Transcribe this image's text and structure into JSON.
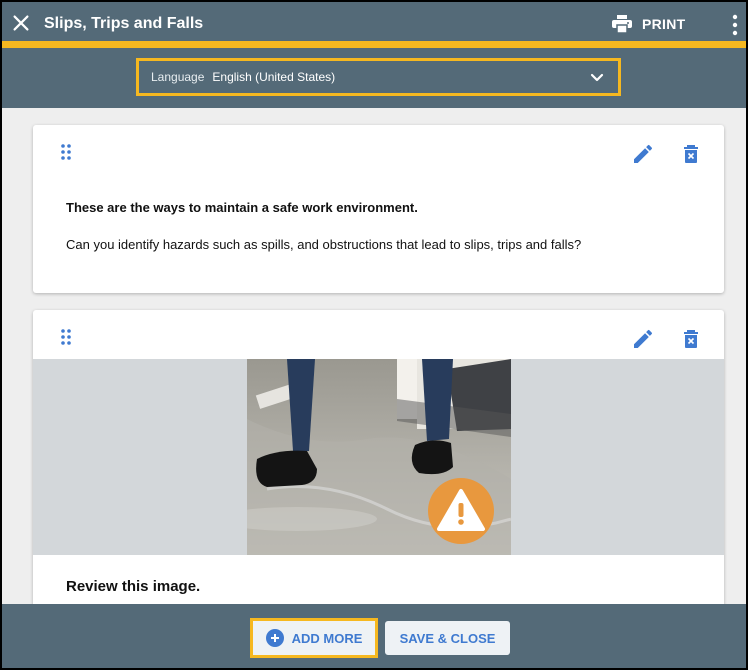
{
  "header": {
    "title": "Slips, Trips and Falls",
    "print_label": "PRINT",
    "accent_color": "#f6b820",
    "bar_color": "#546a78"
  },
  "language": {
    "label": "Language",
    "value": "English (United States)"
  },
  "cards": [
    {
      "heading": "These are the ways to maintain a safe work environment.",
      "body": "Can you identify hazards such as spills, and obstructions that lead to slips, trips and falls?"
    },
    {
      "caption": "Review this image.",
      "image_alt": "Worker shoes on a slippery wet floor with warning icon"
    }
  ],
  "footer": {
    "add_more_label": "ADD MORE",
    "save_close_label": "SAVE & CLOSE",
    "button_text_color": "#3f7ad0"
  }
}
